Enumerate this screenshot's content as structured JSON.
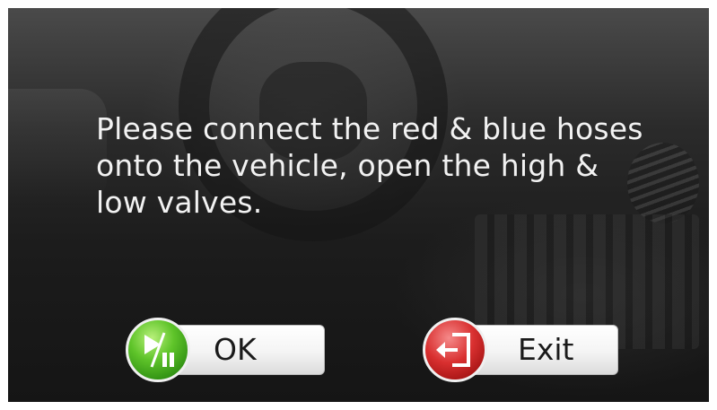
{
  "dialog": {
    "message": "Please connect the red & blue hoses onto the vehicle, open the high & low valves."
  },
  "buttons": {
    "ok": {
      "label": "OK",
      "icon": "play-pause-icon",
      "color": "#4caf1f"
    },
    "exit": {
      "label": "Exit",
      "icon": "exit-door-icon",
      "color": "#c62828"
    }
  }
}
